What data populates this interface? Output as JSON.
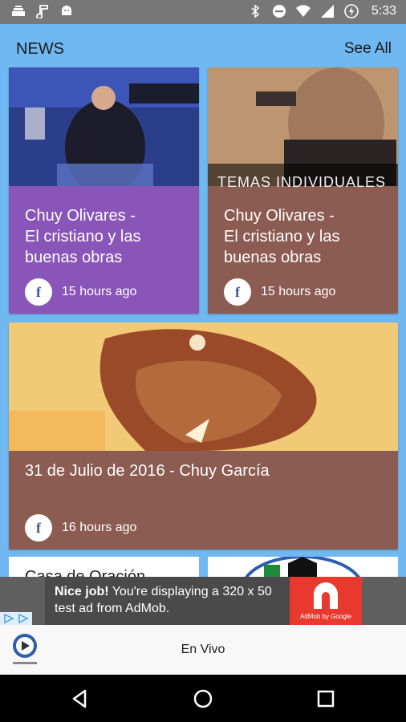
{
  "status_bar": {
    "time": "5:33",
    "left_icons": [
      "tray-icon",
      "music-note-icon",
      "android-icon"
    ],
    "right_icons": [
      "bluetooth-icon",
      "do-not-disturb-icon",
      "wifi-icon",
      "signal-icon",
      "battery-saver-icon"
    ]
  },
  "header": {
    "title": "NEWS",
    "see_all": "See All"
  },
  "cards": [
    {
      "title": "Chuy Olivares -\nEl cristiano y las\nbuenas obras",
      "time": "15 hours ago",
      "source_icon": "facebook-icon",
      "color": "#8a55b8"
    },
    {
      "title": "Chuy Olivares -\nEl cristiano y las\nbuenas obras",
      "time": "15 hours ago",
      "source_icon": "facebook-icon",
      "color": "#8c5c52",
      "image_text": "TEMAS INDIVIDUALES"
    },
    {
      "title": "31 de Julio de 2016 - Chuy García",
      "time": "16 hours ago",
      "source_icon": "facebook-icon",
      "color": "#8c5c52"
    }
  ],
  "partial_card_text": "Casa de Oración",
  "ad": {
    "bold": "Nice job!",
    "text": " You're displaying a 320 x 50 test ad from AdMob.",
    "brand": "AdMob by Google"
  },
  "bottom_bar": {
    "label": "En Vivo"
  },
  "nav": [
    "back-icon",
    "home-icon",
    "recents-icon"
  ]
}
